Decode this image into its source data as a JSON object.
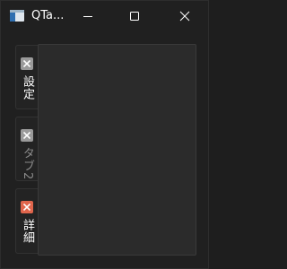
{
  "window": {
    "title": "QTa..."
  },
  "title_buttons": {
    "minimize": "minimize-icon",
    "maximize": "maximize-icon",
    "close": "close-icon"
  },
  "tabs": [
    {
      "label": "設定",
      "label_color": "#ffffff",
      "close_color": "#9a9a9a",
      "selected": false,
      "enabled": true
    },
    {
      "label": "タブ2",
      "label_color": "#8a8a8a",
      "close_color": "#9a9a9a",
      "selected": false,
      "enabled": false
    },
    {
      "label": "詳細",
      "label_color": "#ffffff",
      "close_color": "#e0654c",
      "selected": false,
      "enabled": true
    }
  ],
  "colors": {
    "window_bg": "#202020",
    "panel_bg": "#2b2b2b",
    "accent_close": "#e0654c"
  }
}
